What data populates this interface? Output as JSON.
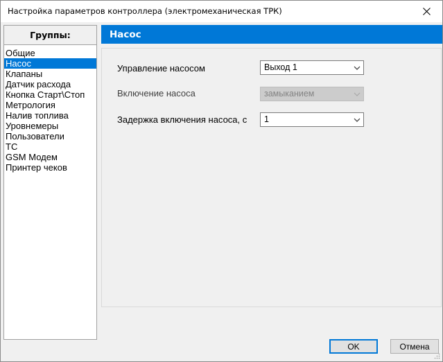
{
  "window": {
    "title": "Настройка параметров контроллера (электромеханическая ТРК)"
  },
  "groups": {
    "header": "Группы:",
    "items": [
      {
        "label": "Общие",
        "selected": false
      },
      {
        "label": "Насос",
        "selected": true
      },
      {
        "label": "Клапаны",
        "selected": false
      },
      {
        "label": "Датчик расхода",
        "selected": false
      },
      {
        "label": "Кнопка Старт\\Стоп",
        "selected": false
      },
      {
        "label": "Метрология",
        "selected": false
      },
      {
        "label": "Налив топлива",
        "selected": false
      },
      {
        "label": "Уровнемеры",
        "selected": false
      },
      {
        "label": "Пользователи",
        "selected": false
      },
      {
        "label": "ТС",
        "selected": false
      },
      {
        "label": "GSM Модем",
        "selected": false
      },
      {
        "label": "Принтер чеков",
        "selected": false
      }
    ]
  },
  "section": {
    "title": "Насос",
    "fields": [
      {
        "label": "Управление насосом",
        "value": "Выход 1",
        "enabled": true
      },
      {
        "label": "Включение насоса",
        "value": "замыканием",
        "enabled": false
      },
      {
        "label": "Задержка включения насоса, с",
        "value": "1",
        "enabled": true
      }
    ]
  },
  "buttons": {
    "ok": "OK",
    "cancel": "Отмена"
  },
  "colors": {
    "accent": "#0078d7",
    "panel_background": "#f0f0f0",
    "disabled_combo": "#cccccc"
  }
}
